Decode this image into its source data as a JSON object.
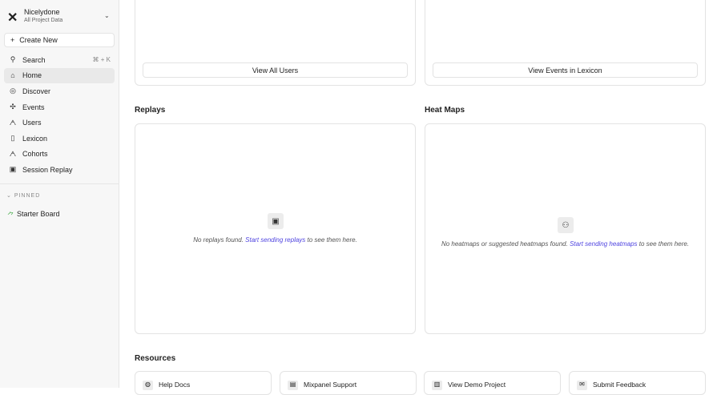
{
  "project": {
    "name": "Nicelydone",
    "subtitle": "All Project Data"
  },
  "sidebar": {
    "create_label": "Create New",
    "search_label": "Search",
    "search_shortcut": "⌘ + K",
    "items": [
      {
        "label": "Home",
        "icon": "⌂"
      },
      {
        "label": "Discover",
        "icon": "◎"
      },
      {
        "label": "Events",
        "icon": "✣"
      },
      {
        "label": "Users",
        "icon": "ᗅ"
      },
      {
        "label": "Lexicon",
        "icon": "▯"
      },
      {
        "label": "Cohorts",
        "icon": "ᗅ"
      },
      {
        "label": "Session Replay",
        "icon": "▣"
      }
    ],
    "pinned_label": "PINNED",
    "pinned_items": [
      {
        "label": "Starter Board"
      }
    ]
  },
  "main": {
    "view_users": "View All Users",
    "view_events": "View Events in Lexicon",
    "replays": {
      "title": "Replays",
      "pre": "No replays found. ",
      "link": "Start sending replays",
      "post": " to see them here."
    },
    "heatmaps": {
      "title": "Heat Maps",
      "pre": "No heatmaps or suggested heatmaps found. ",
      "link": "Start sending heatmaps",
      "post": " to see them here."
    },
    "resources_title": "Resources",
    "resources": [
      {
        "label": "Help Docs",
        "icon": "◍"
      },
      {
        "label": "Mixpanel Support",
        "icon": "▤"
      },
      {
        "label": "View Demo Project",
        "icon": "▥"
      },
      {
        "label": "Submit Feedback",
        "icon": "✉"
      }
    ]
  },
  "colors": {
    "link": "#4f44e0"
  }
}
